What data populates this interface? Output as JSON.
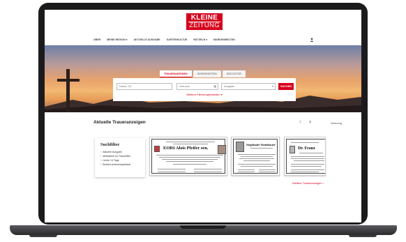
{
  "logo": {
    "line1": "KLEINE",
    "line2": "ZEITUNG"
  },
  "nav": {
    "items": [
      "Über",
      "Meine Region",
      "Aktuelle Ausgabe",
      "Gartenkultur",
      "Rätseln",
      "Markenwelten"
    ]
  },
  "search": {
    "tabs": [
      "Traueranzeigen",
      "Gedenkseiten",
      "Bestatter"
    ],
    "name_placeholder": "Name, Ort",
    "date_placeholder": "Zeitraum",
    "edition_placeholder": "Ausgabe",
    "submit_label": "SUCHEN",
    "more_filters_label": "Weitere Filtermöglichkeiten"
  },
  "main": {
    "section_title": "Aktuelle Traueranzeigen",
    "ad_label": "Werbung",
    "filter": {
      "title": "Suchfilter",
      "items": [
        "Aktuelle Ausgabe",
        "Mediathek für Trauerfälle",
        "Letzte 14 Tage",
        "Bezirk/Landeshauptstadt"
      ]
    },
    "cards": [
      {
        "name": "EORI Alois Pfeifer sen."
      },
      {
        "name": "Stephanie Steinbauer"
      },
      {
        "name": "Dr. Franz"
      }
    ],
    "more_link": "Weitere Traueranzeigen"
  },
  "colors": {
    "brand_red": "#d6001c",
    "laptop_frame": "#1b1b1d"
  }
}
